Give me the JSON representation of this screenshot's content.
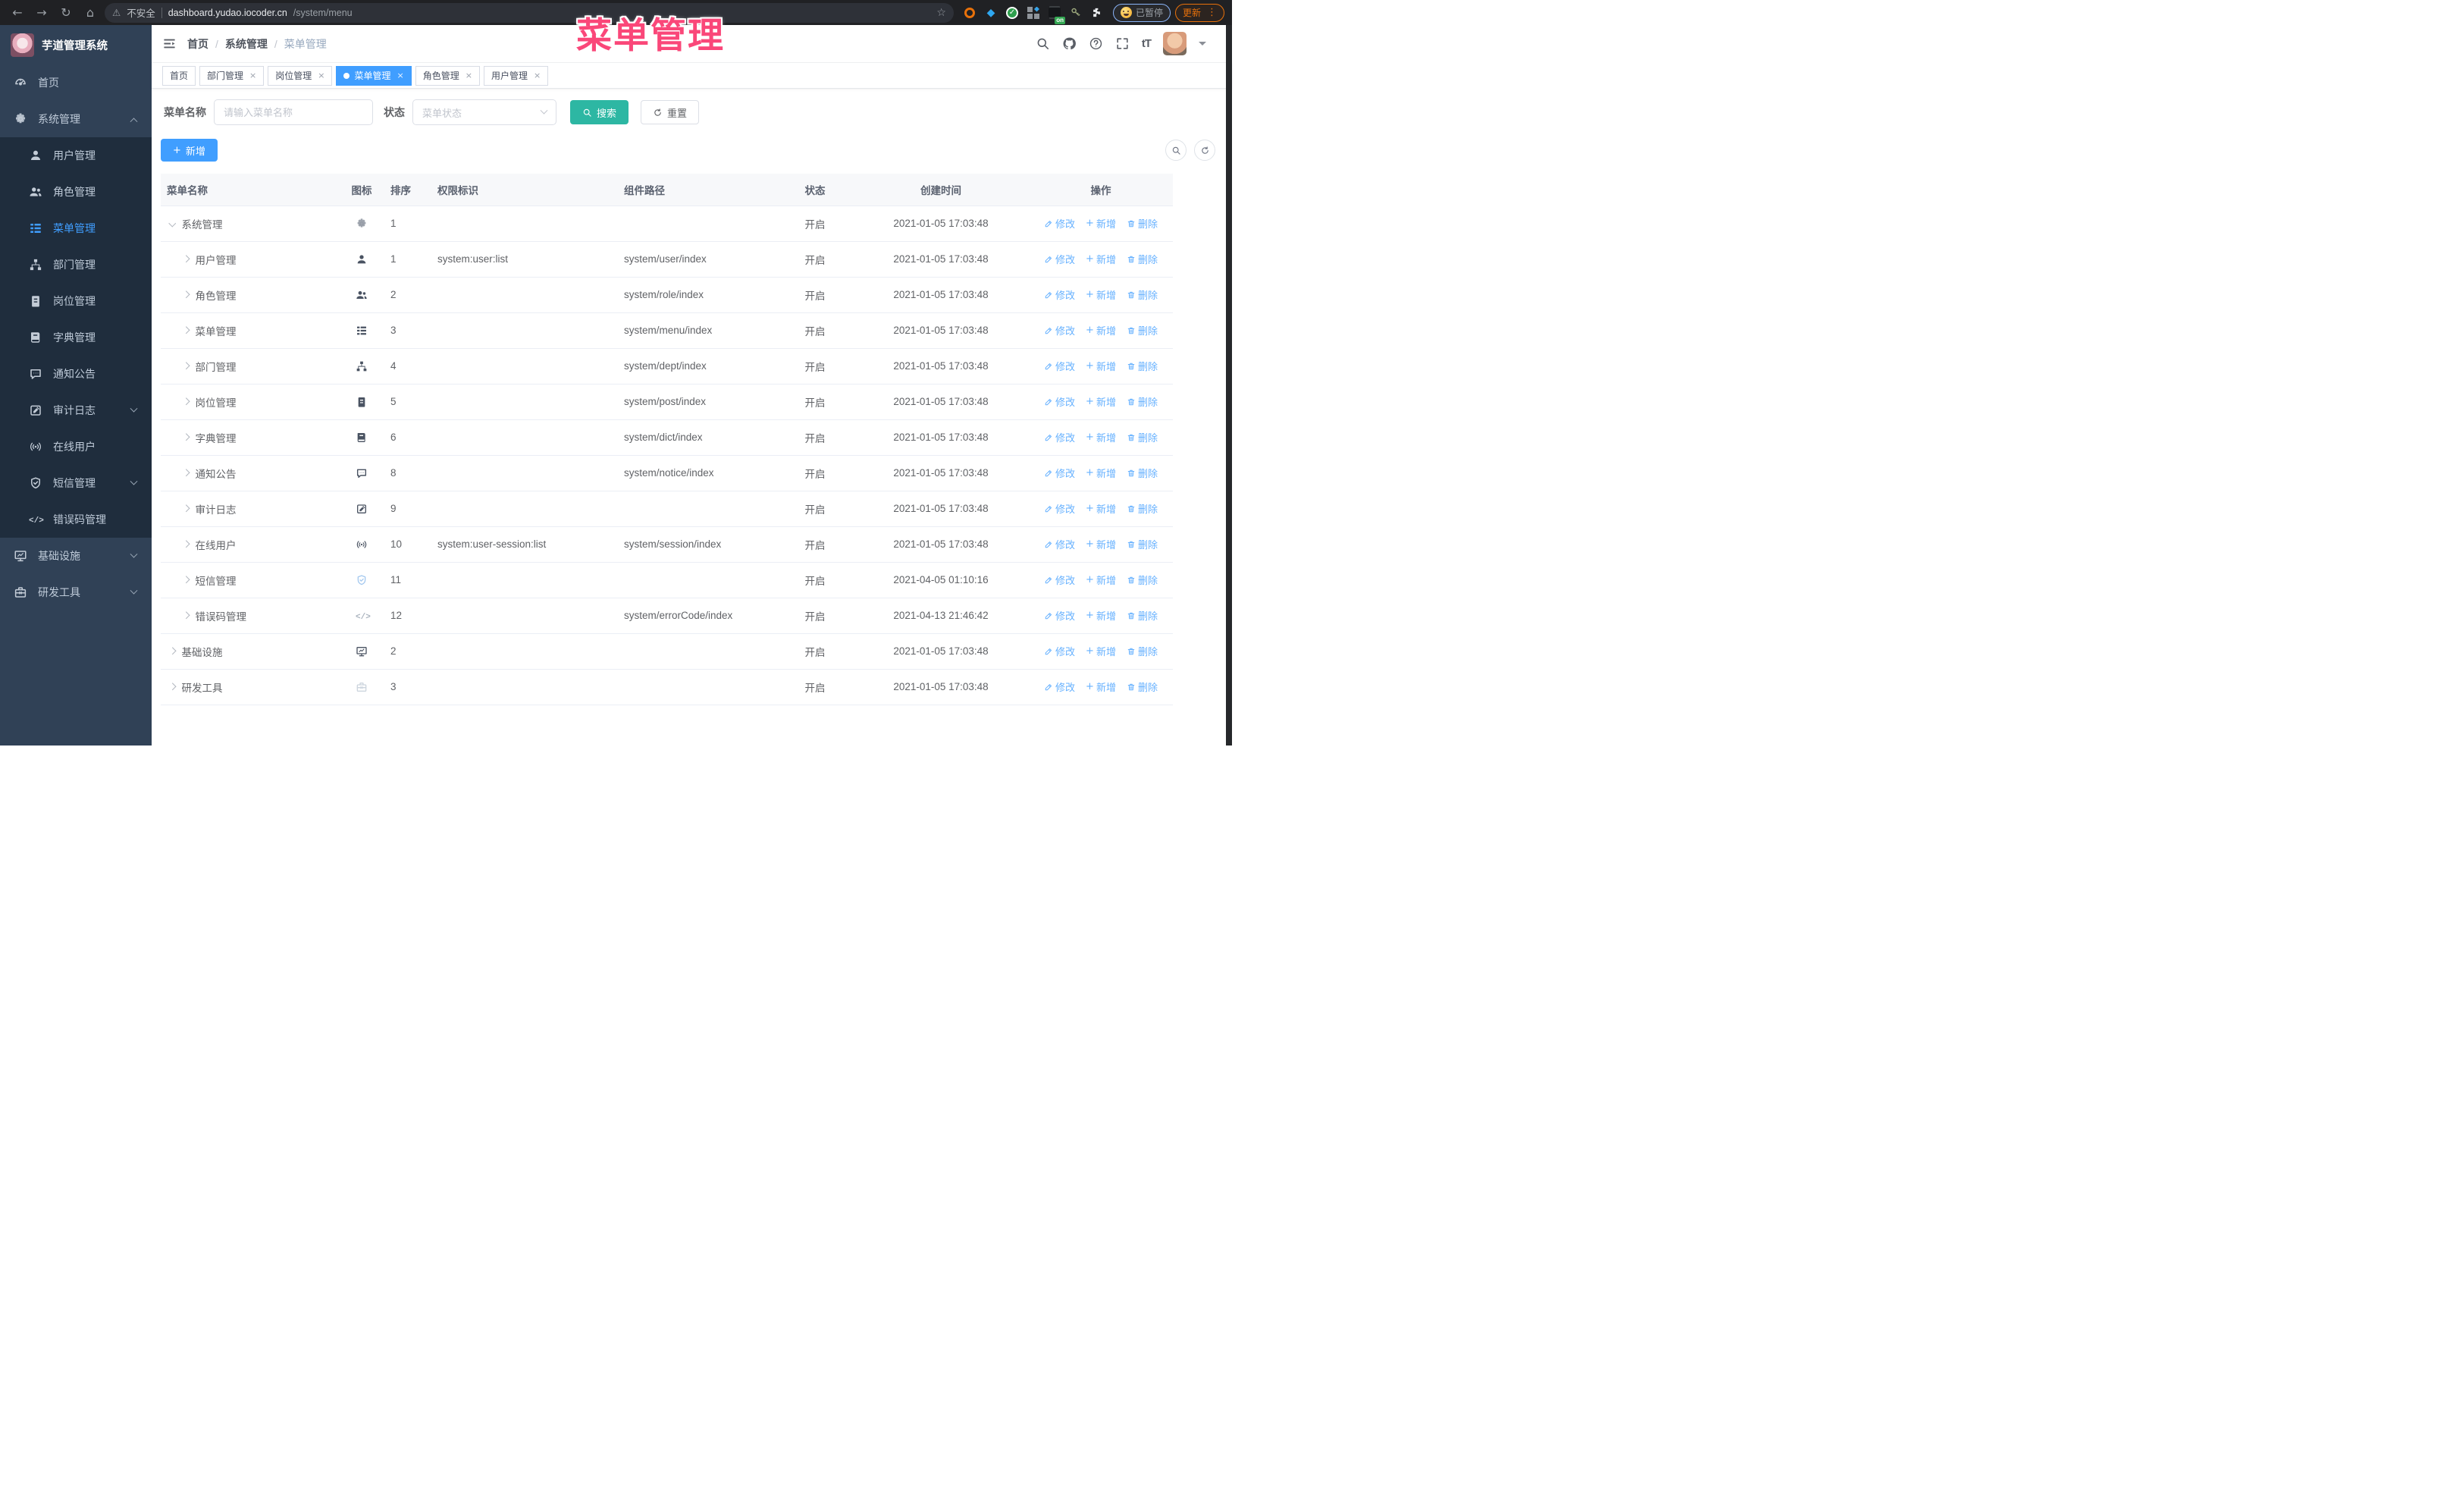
{
  "browser": {
    "security_label": "不安全",
    "url_host": "dashboard.yudao.iocoder.cn",
    "url_path": "/system/menu",
    "paused_label": "已暂停",
    "update_label": "更新",
    "extension_on_badge": "on"
  },
  "overlay": {
    "title": "菜单管理",
    "color": "#fa4779"
  },
  "sidebar": {
    "logo_title": "芋道管理系统",
    "items": [
      {
        "key": "home",
        "label": "首页",
        "icon": "gauge",
        "sub": false
      },
      {
        "key": "system-management",
        "label": "系统管理",
        "icon": "gear",
        "sub": false,
        "arrow": "up"
      },
      {
        "key": "user-management",
        "label": "用户管理",
        "icon": "user",
        "sub": true
      },
      {
        "key": "role-management",
        "label": "角色管理",
        "icon": "peoples",
        "sub": true
      },
      {
        "key": "menu-management",
        "label": "菜单管理",
        "icon": "tree-table",
        "sub": true,
        "active": true
      },
      {
        "key": "dept-management",
        "label": "部门管理",
        "icon": "tree",
        "sub": true
      },
      {
        "key": "post-management",
        "label": "岗位管理",
        "icon": "post",
        "sub": true
      },
      {
        "key": "dict-management",
        "label": "字典管理",
        "icon": "dict",
        "sub": true
      },
      {
        "key": "notice-announcement",
        "label": "通知公告",
        "icon": "message",
        "sub": true
      },
      {
        "key": "audit-log",
        "label": "审计日志",
        "icon": "log",
        "sub": true,
        "arrow": "down"
      },
      {
        "key": "online-users",
        "label": "在线用户",
        "icon": "online",
        "sub": true
      },
      {
        "key": "sms-management",
        "label": "短信管理",
        "icon": "shield",
        "sub": true,
        "arrow": "down"
      },
      {
        "key": "error-code-management",
        "label": "错误码管理",
        "icon": "code",
        "sub": true
      },
      {
        "key": "infrastructure",
        "label": "基础设施",
        "icon": "monitor",
        "sub": false,
        "arrow": "down"
      },
      {
        "key": "dev-tools",
        "label": "研发工具",
        "icon": "toolbox",
        "sub": false,
        "arrow": "down"
      }
    ]
  },
  "navbar": {
    "breadcrumb": [
      "首页",
      "系统管理",
      "菜单管理"
    ]
  },
  "tabs": [
    {
      "label": "首页",
      "closable": false,
      "active": false
    },
    {
      "label": "部门管理",
      "closable": true,
      "active": false
    },
    {
      "label": "岗位管理",
      "closable": true,
      "active": false
    },
    {
      "label": "菜单管理",
      "closable": true,
      "active": true
    },
    {
      "label": "角色管理",
      "closable": true,
      "active": false
    },
    {
      "label": "用户管理",
      "closable": true,
      "active": false
    }
  ],
  "filters": {
    "name_label": "菜单名称",
    "name_placeholder": "请输入菜单名称",
    "status_label": "状态",
    "status_placeholder": "菜单状态",
    "search_label": "搜索",
    "reset_label": "重置"
  },
  "toolbar": {
    "add_label": "新增"
  },
  "table": {
    "columns": [
      "菜单名称",
      "图标",
      "排序",
      "权限标识",
      "组件路径",
      "状态",
      "创建时间",
      "操作"
    ],
    "ops_labels": {
      "edit": "修改",
      "add": "新增",
      "delete": "删除"
    },
    "rows": [
      {
        "name": "系统管理",
        "level": 0,
        "expanded": true,
        "icon": "gear",
        "tone": "mid",
        "sort": "1",
        "perm": "",
        "path": "",
        "status": "开启",
        "time": "2021-01-05 17:03:48"
      },
      {
        "name": "用户管理",
        "level": 1,
        "expanded": false,
        "icon": "user",
        "tone": "dark",
        "sort": "1",
        "perm": "system:user:list",
        "path": "system/user/index",
        "status": "开启",
        "time": "2021-01-05 17:03:48"
      },
      {
        "name": "角色管理",
        "level": 1,
        "expanded": false,
        "icon": "peoples",
        "tone": "dark",
        "sort": "2",
        "perm": "",
        "path": "system/role/index",
        "status": "开启",
        "time": "2021-01-05 17:03:48"
      },
      {
        "name": "菜单管理",
        "level": 1,
        "expanded": false,
        "icon": "tree-table",
        "tone": "dark",
        "sort": "3",
        "perm": "",
        "path": "system/menu/index",
        "status": "开启",
        "time": "2021-01-05 17:03:48"
      },
      {
        "name": "部门管理",
        "level": 1,
        "expanded": false,
        "icon": "tree",
        "tone": "dark",
        "sort": "4",
        "perm": "",
        "path": "system/dept/index",
        "status": "开启",
        "time": "2021-01-05 17:03:48"
      },
      {
        "name": "岗位管理",
        "level": 1,
        "expanded": false,
        "icon": "post",
        "tone": "dark",
        "sort": "5",
        "perm": "",
        "path": "system/post/index",
        "status": "开启",
        "time": "2021-01-05 17:03:48"
      },
      {
        "name": "字典管理",
        "level": 1,
        "expanded": false,
        "icon": "dict",
        "tone": "dark",
        "sort": "6",
        "perm": "",
        "path": "system/dict/index",
        "status": "开启",
        "time": "2021-01-05 17:03:48"
      },
      {
        "name": "通知公告",
        "level": 1,
        "expanded": false,
        "icon": "message",
        "tone": "dark",
        "sort": "8",
        "perm": "",
        "path": "system/notice/index",
        "status": "开启",
        "time": "2021-01-05 17:03:48"
      },
      {
        "name": "审计日志",
        "level": 1,
        "expanded": false,
        "icon": "log",
        "tone": "dark",
        "sort": "9",
        "perm": "",
        "path": "",
        "status": "开启",
        "time": "2021-01-05 17:03:48"
      },
      {
        "name": "在线用户",
        "level": 1,
        "expanded": false,
        "icon": "online",
        "tone": "dark",
        "sort": "10",
        "perm": "system:user-session:list",
        "path": "system/session/index",
        "status": "开启",
        "time": "2021-01-05 17:03:48"
      },
      {
        "name": "短信管理",
        "level": 1,
        "expanded": false,
        "icon": "shield",
        "tone": "blue",
        "sort": "11",
        "perm": "",
        "path": "",
        "status": "开启",
        "time": "2021-04-05 01:10:16"
      },
      {
        "name": "错误码管理",
        "level": 1,
        "expanded": false,
        "icon": "code",
        "tone": "mono",
        "sort": "12",
        "perm": "",
        "path": "system/errorCode/index",
        "status": "开启",
        "time": "2021-04-13 21:46:42"
      },
      {
        "name": "基础设施",
        "level": 0,
        "expanded": false,
        "icon": "monitor",
        "tone": "dark",
        "sort": "2",
        "perm": "",
        "path": "",
        "status": "开启",
        "time": "2021-01-05 17:03:48"
      },
      {
        "name": "研发工具",
        "level": 0,
        "expanded": false,
        "icon": "toolbox",
        "tone": "xlight",
        "sort": "3",
        "perm": "",
        "path": "",
        "status": "开启",
        "time": "2021-01-05 17:03:48"
      }
    ]
  }
}
